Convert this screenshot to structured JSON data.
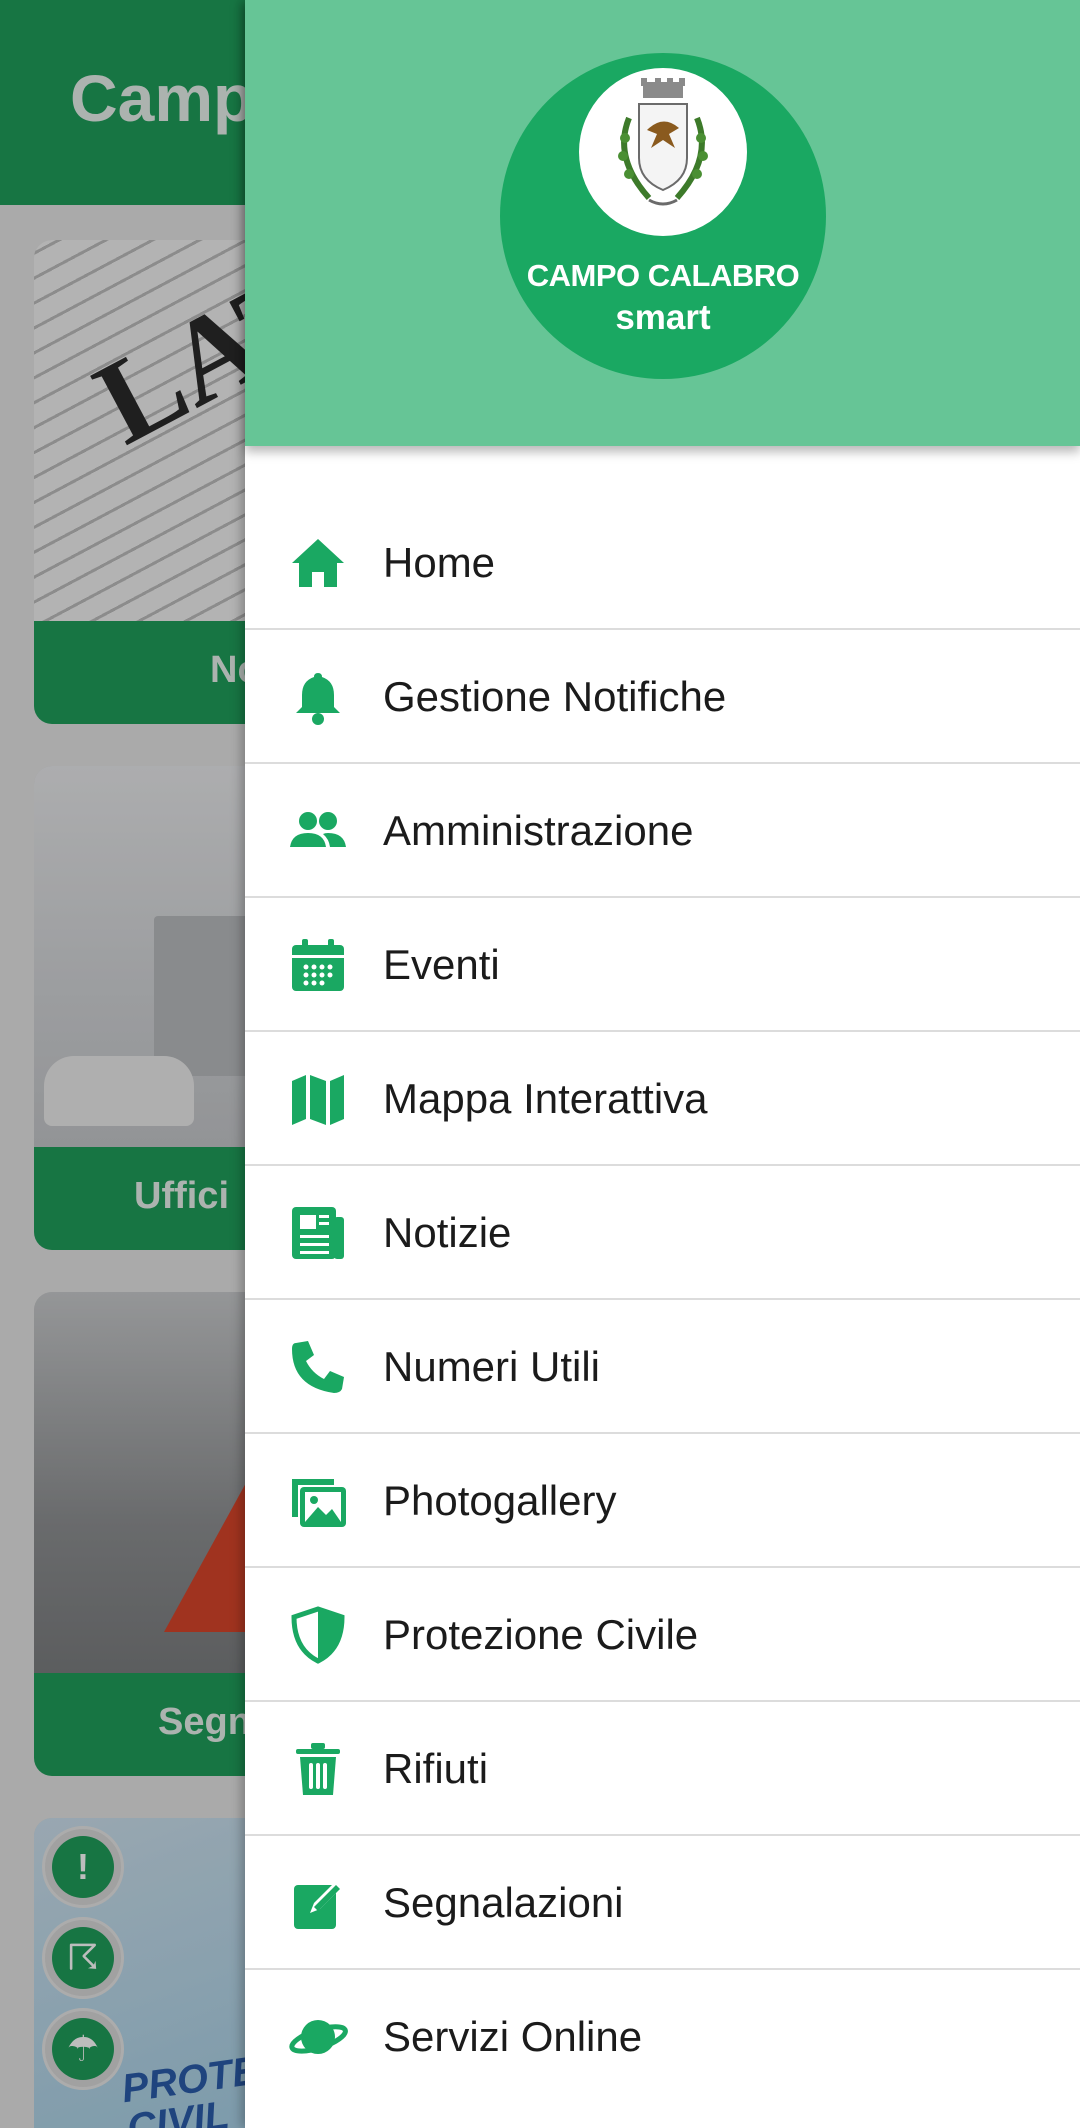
{
  "app": {
    "title": "Campo Calabro smart"
  },
  "background_cards": [
    {
      "label": "Notizie",
      "image": "newspaper"
    },
    {
      "label": "Uffici",
      "image": "office"
    },
    {
      "label": "Segnalazioni",
      "image": "warning-triangle"
    },
    {
      "label": "",
      "image": "protezione-civile"
    }
  ],
  "background_card_text": {
    "headline": "LAT",
    "vest": "PROTEZ\nCIVIL"
  },
  "floating_buttons": [
    {
      "icon": "alert-icon",
      "glyph": "!"
    },
    {
      "icon": "storm-icon",
      "glyph": "☈"
    },
    {
      "icon": "rain-icon",
      "glyph": "☂"
    }
  ],
  "drawer": {
    "logo": {
      "line1": "CAMPO CALABRO",
      "line2": "smart",
      "crest": "coat-of-arms"
    },
    "menu": [
      {
        "label": "Home",
        "icon": "home-icon"
      },
      {
        "label": "Gestione Notifiche",
        "icon": "bell-icon"
      },
      {
        "label": "Amministrazione",
        "icon": "people-icon"
      },
      {
        "label": "Eventi",
        "icon": "calendar-icon"
      },
      {
        "label": "Mappa Interattiva",
        "icon": "map-icon"
      },
      {
        "label": "Notizie",
        "icon": "newspaper-icon"
      },
      {
        "label": "Numeri Utili",
        "icon": "phone-icon"
      },
      {
        "label": "Photogallery",
        "icon": "images-icon"
      },
      {
        "label": "Protezione Civile",
        "icon": "shield-icon"
      },
      {
        "label": "Rifiuti",
        "icon": "trash-icon"
      },
      {
        "label": "Segnalazioni",
        "icon": "edit-icon"
      },
      {
        "label": "Servizi Online",
        "icon": "planet-icon"
      }
    ]
  },
  "colors": {
    "primary": "#1f9e5b",
    "drawer_header": "#66c596",
    "icon": "#1aa862",
    "logo_circle": "#1aa862"
  }
}
